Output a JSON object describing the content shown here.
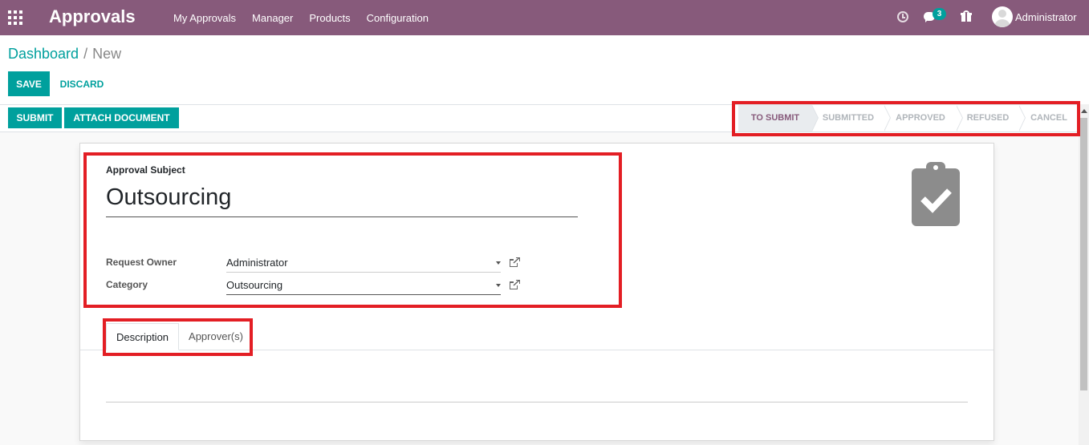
{
  "navbar": {
    "app_title": "Approvals",
    "menu": [
      "My Approvals",
      "Manager",
      "Products",
      "Configuration"
    ],
    "chat_count": "3",
    "user": "Administrator"
  },
  "breadcrumb": {
    "parent": "Dashboard",
    "separator": "/",
    "current": "New"
  },
  "actions": {
    "save": "SAVE",
    "discard": "DISCARD"
  },
  "header_buttons": {
    "submit": "SUBMIT",
    "attach": "ATTACH DOCUMENT"
  },
  "stages": [
    "TO SUBMIT",
    "SUBMITTED",
    "APPROVED",
    "REFUSED",
    "CANCEL"
  ],
  "active_stage": "TO SUBMIT",
  "form": {
    "subject_label": "Approval Subject",
    "subject_value": "Outsourcing",
    "request_owner_label": "Request Owner",
    "request_owner_value": "Administrator",
    "category_label": "Category",
    "category_value": "Outsourcing"
  },
  "tabs": [
    "Description",
    "Approver(s)"
  ],
  "colors": {
    "brand": "#875A7B",
    "accent": "#00A09D",
    "highlight": "#e31e24"
  },
  "icons": [
    "apps-grid-icon",
    "clock-icon",
    "chat-icon",
    "gift-icon",
    "clipboard-check-icon",
    "external-link-icon",
    "chevron-down-icon"
  ]
}
